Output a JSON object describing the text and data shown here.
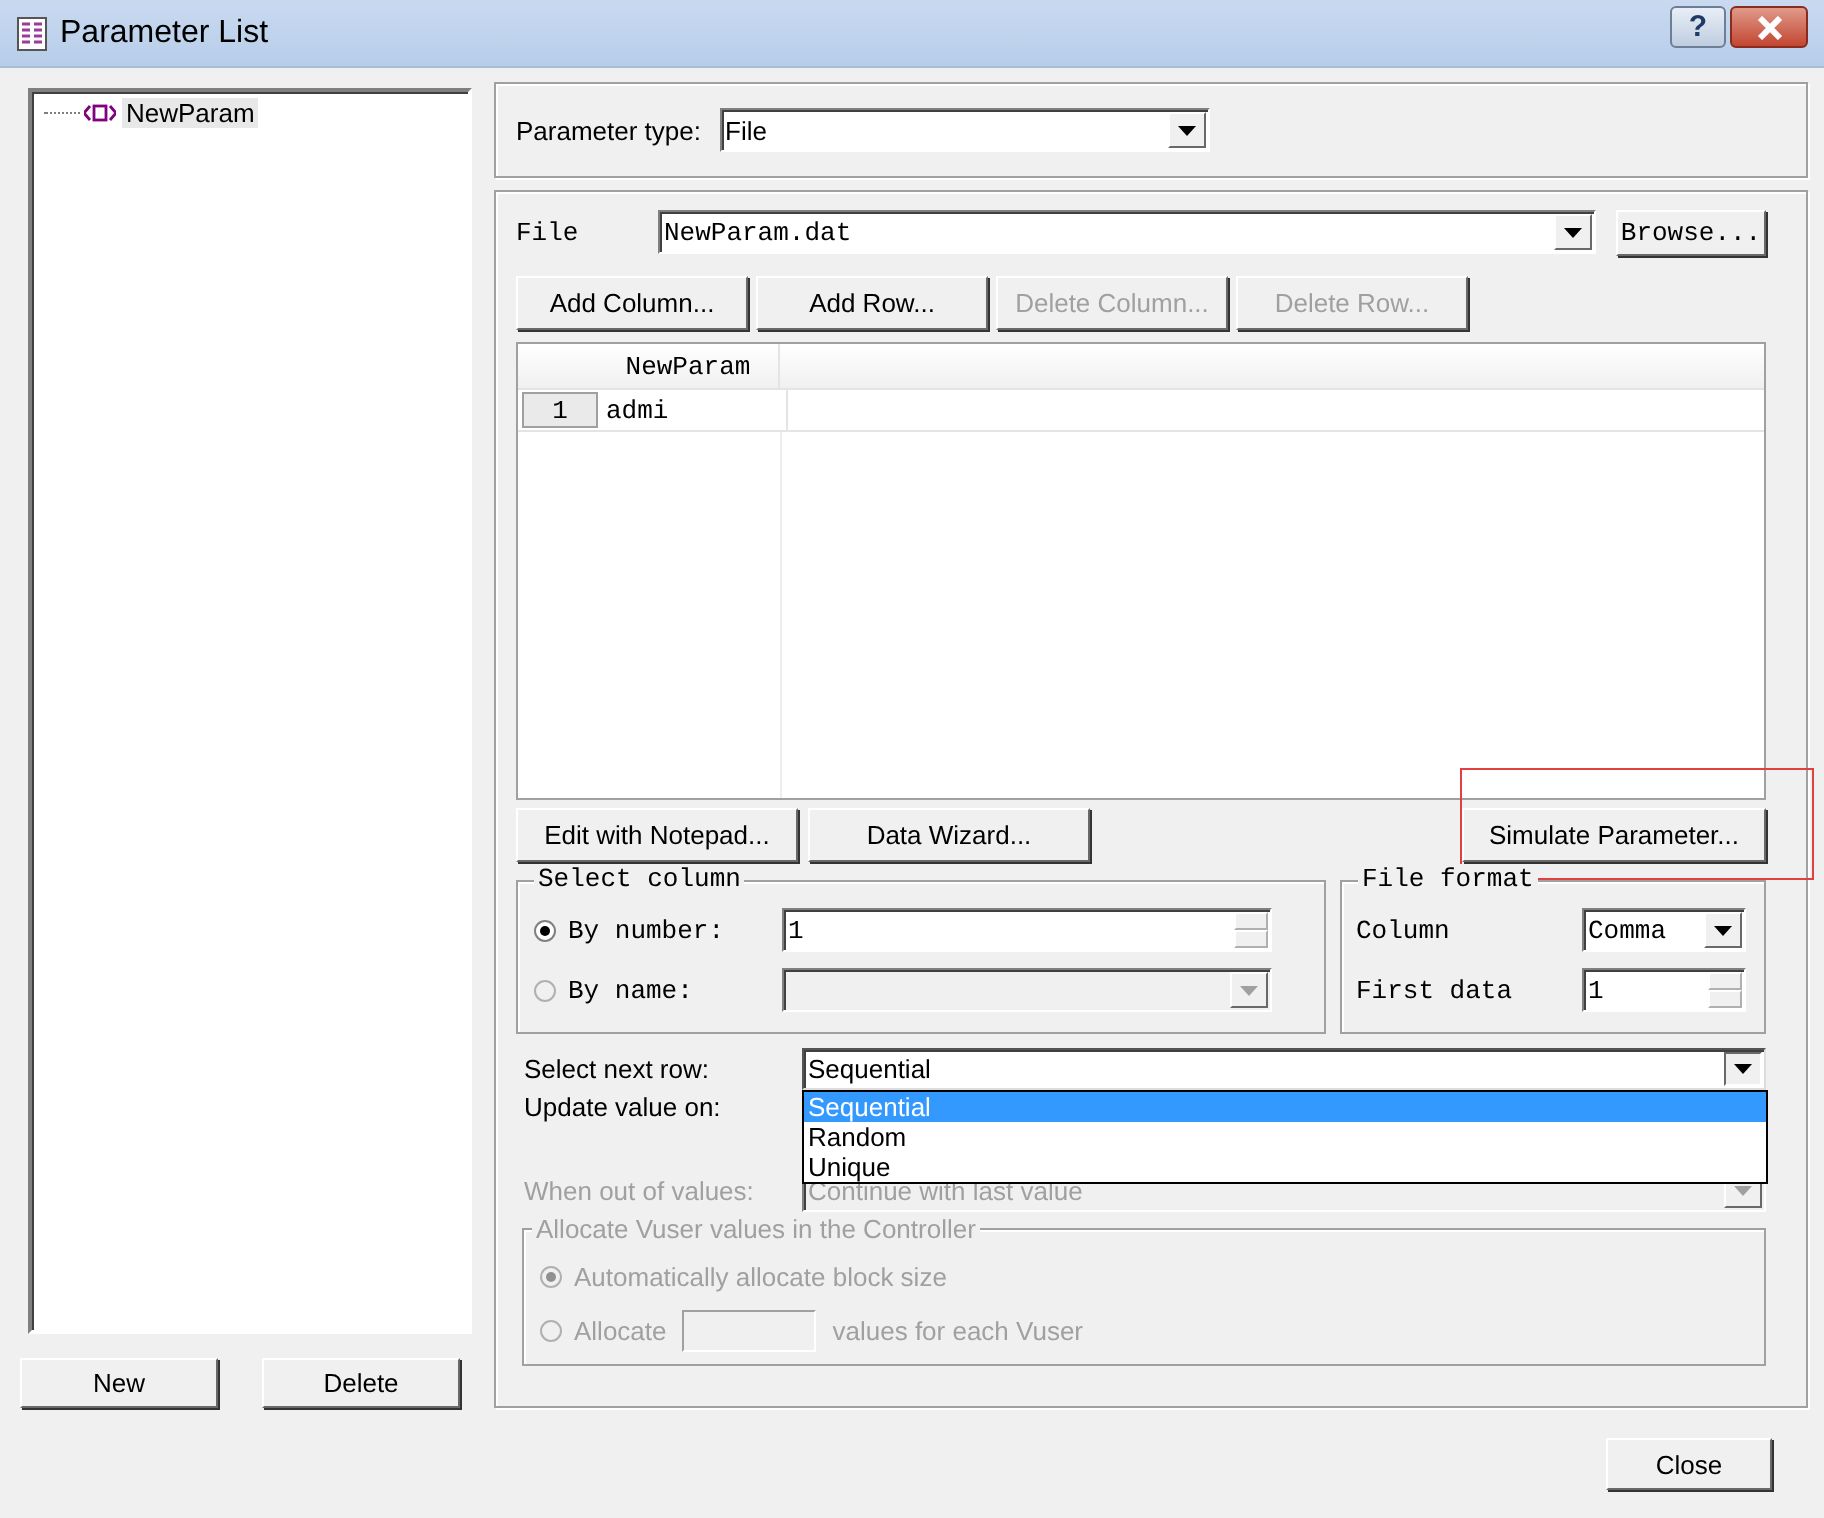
{
  "window": {
    "title": "Parameter List",
    "help": "?"
  },
  "tree": [
    {
      "label": "NewParam",
      "selected": true
    }
  ],
  "left_buttons": [
    "New",
    "Delete"
  ],
  "parameter_type": {
    "label": "Parameter type:",
    "value": "File"
  },
  "file": {
    "label": "File",
    "value": "NewParam.dat",
    "browse": "Browse..."
  },
  "table_buttons": [
    {
      "label": "Add Column...",
      "disabled": false
    },
    {
      "label": "Add Row...",
      "disabled": false
    },
    {
      "label": "Delete Column...",
      "disabled": true
    },
    {
      "label": "Delete Row...",
      "disabled": true
    }
  ],
  "table": {
    "columns": [
      "NewParam"
    ],
    "rows": [
      {
        "number": "1",
        "cells": [
          "admi"
        ]
      }
    ]
  },
  "data_buttons": [
    {
      "label": "Edit with Notepad...",
      "highlighted": false
    },
    {
      "label": "Data Wizard...",
      "highlighted": false
    },
    {
      "label": "Simulate Parameter...",
      "highlighted": true
    }
  ],
  "select_column": {
    "title": "Select column",
    "options": [
      {
        "label": "By number:",
        "selected": true,
        "disabled": false,
        "value": "1"
      },
      {
        "label": "By name:",
        "selected": false,
        "disabled": true
      }
    ]
  },
  "file_format": {
    "title": "File format",
    "column_label": "Column",
    "column_value": "Comma",
    "first_data_label": "First data",
    "first_data_value": "1"
  },
  "select_next_row": {
    "label": "Select next row:",
    "value": "Sequential",
    "expanded": true,
    "options": [
      {
        "label": "Sequential",
        "selected": true
      },
      {
        "label": "Random",
        "selected": false
      },
      {
        "label": "Unique",
        "selected": false
      }
    ]
  },
  "update_value_on": {
    "label": "Update value on:"
  },
  "when_out_of_values": {
    "label": "When out of values:",
    "value": "Continue with last value",
    "disabled": true
  },
  "allocate": {
    "title": "Allocate Vuser values in the Controller",
    "disabled": true,
    "options": [
      {
        "label": "Automatically allocate block size",
        "selected": true
      },
      {
        "label": "Allocate",
        "selected": false,
        "suffix": "values for each Vuser"
      }
    ]
  },
  "close_button": "Close"
}
